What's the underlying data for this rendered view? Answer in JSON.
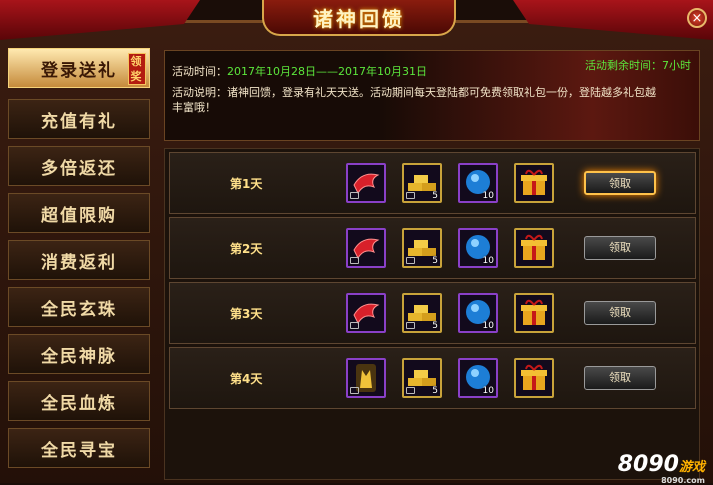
{
  "title": "诸神回馈",
  "close_glyph": "×",
  "sidebar": {
    "items": [
      {
        "label": "登录送礼",
        "badge": "领奖"
      },
      {
        "label": "充值有礼"
      },
      {
        "label": "多倍返还"
      },
      {
        "label": "超值限购"
      },
      {
        "label": "消费返利"
      },
      {
        "label": "全民玄珠"
      },
      {
        "label": "全民神脉"
      },
      {
        "label": "全民血炼"
      },
      {
        "label": "全民寻宝"
      }
    ]
  },
  "info": {
    "time_label": "活动时间：",
    "time_value": "2017年10月28日——2017年10月31日",
    "remain": "活动剩余时间：7小时",
    "desc": "活动说明：诸神回馈，登录有礼天天送。活动期间每天登陆都可免费领取礼包一份，登陆越多礼包越丰富哦！"
  },
  "days": [
    {
      "label": "第1天",
      "items": [
        {
          "icon": "red-wing-icon",
          "count": ""
        },
        {
          "icon": "gold-bars-icon",
          "count": "5"
        },
        {
          "icon": "blue-orb-icon",
          "count": "10"
        },
        {
          "icon": "gift-box-icon",
          "count": ""
        }
      ],
      "button": "领取",
      "highlight": true
    },
    {
      "label": "第2天",
      "items": [
        {
          "icon": "red-wing-icon",
          "count": ""
        },
        {
          "icon": "gold-bars-icon",
          "count": "5"
        },
        {
          "icon": "blue-orb-icon",
          "count": "10"
        },
        {
          "icon": "gift-box-icon",
          "count": ""
        }
      ],
      "button": "领取",
      "highlight": false
    },
    {
      "label": "第3天",
      "items": [
        {
          "icon": "red-wing-icon",
          "count": ""
        },
        {
          "icon": "gold-bars-icon",
          "count": "5"
        },
        {
          "icon": "blue-orb-icon",
          "count": "10"
        },
        {
          "icon": "gift-box-icon",
          "count": ""
        }
      ],
      "button": "领取",
      "highlight": false
    },
    {
      "label": "第4天",
      "items": [
        {
          "icon": "golden-armor-icon",
          "count": ""
        },
        {
          "icon": "gold-bars-icon",
          "count": "5"
        },
        {
          "icon": "blue-orb-icon",
          "count": "10"
        },
        {
          "icon": "gift-box-icon",
          "count": ""
        }
      ],
      "button": "领取",
      "highlight": false
    }
  ],
  "logo": {
    "main": "8090",
    "sub": "游戏",
    "url": "8090.com"
  }
}
